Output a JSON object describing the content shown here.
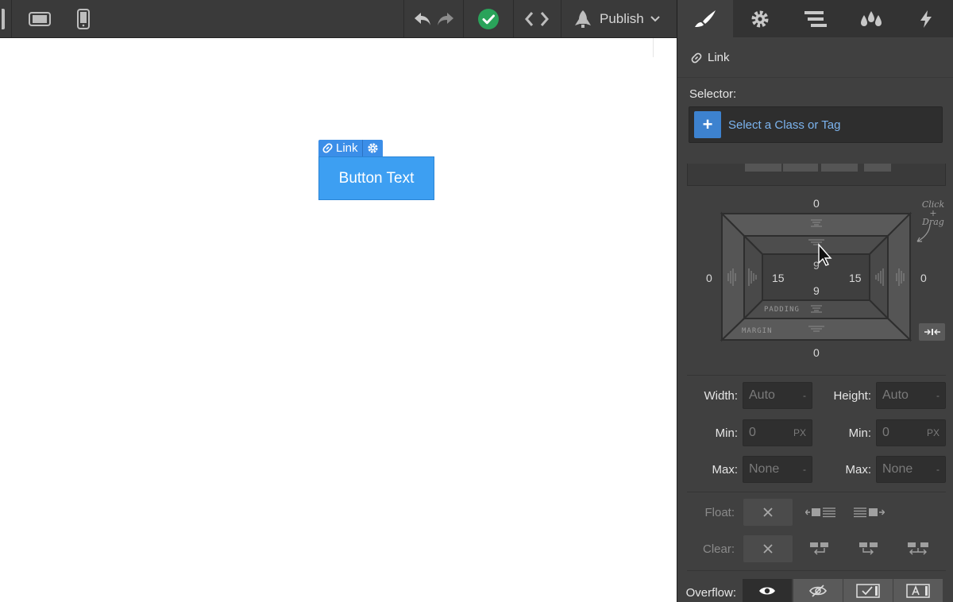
{
  "toolbar": {
    "publish_label": "Publish",
    "icons": [
      "desktop-view-icon",
      "tablet-landscape-icon",
      "phone-icon",
      "undo-icon",
      "redo-icon",
      "check-icon",
      "code-icon",
      "rocket-icon",
      "chevron-down-icon"
    ],
    "status_color": "#2aa35a"
  },
  "canvas": {
    "selected_tag": "Link",
    "button_text": "Button Text",
    "selection_color": "#3b8ee8"
  },
  "panel": {
    "tabs": [
      "style-brush-icon",
      "settings-gear-icon",
      "navigator-icon",
      "swatches-icon",
      "interactions-bolt-icon"
    ],
    "element_type": "Link",
    "selector_label": "Selector:",
    "selector_placeholder": "Select a Class or Tag",
    "box_model": {
      "margin_top": "0",
      "margin_right": "0",
      "margin_bottom": "0",
      "margin_left": "0",
      "padding_top": "9",
      "padding_right": "15",
      "padding_bottom": "9",
      "padding_left": "15",
      "padding_label": "PADDING",
      "margin_label": "MARGIN",
      "hint_line1": "Click",
      "hint_line2": "+",
      "hint_line3": "Drag"
    },
    "size": {
      "width_label": "Width:",
      "width_value": "Auto",
      "width_unit": "-",
      "height_label": "Height:",
      "height_value": "Auto",
      "height_unit": "-",
      "min_label": "Min:",
      "min_w_value": "0",
      "min_w_unit": "PX",
      "min_h_value": "0",
      "min_h_unit": "PX",
      "max_label": "Max:",
      "max_w_value": "None",
      "max_w_unit": "-",
      "max_h_value": "None",
      "max_h_unit": "-"
    },
    "float_label": "Float:",
    "clear_label": "Clear:",
    "overflow_label": "Overflow:"
  }
}
